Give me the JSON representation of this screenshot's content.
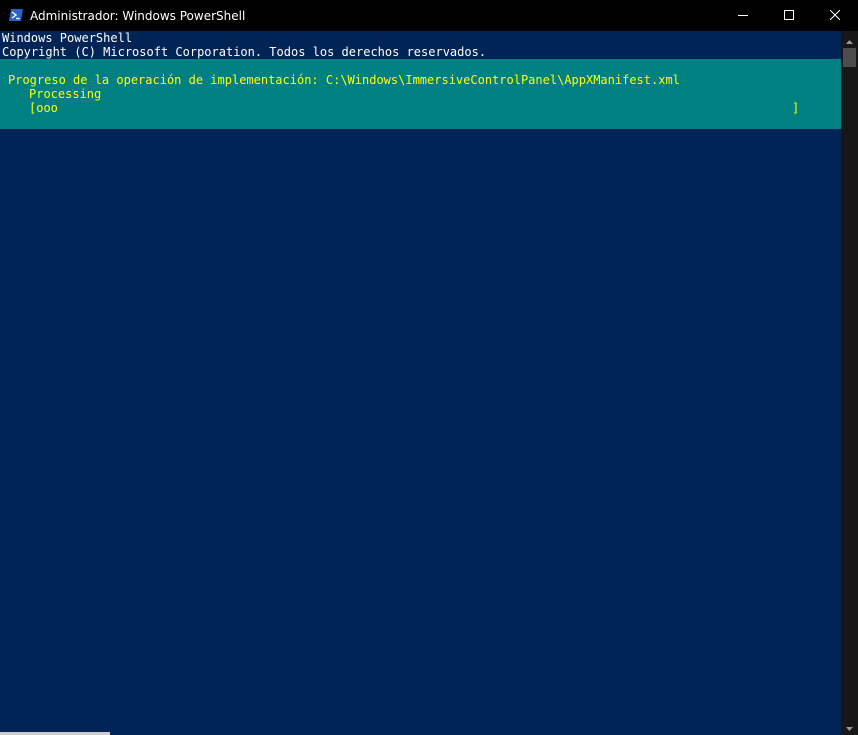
{
  "window": {
    "title": "Administrador: Windows PowerShell",
    "icon": "powershell-icon",
    "controls": {
      "minimize": "minimize-icon",
      "maximize": "maximize-icon",
      "close": "close-icon"
    }
  },
  "console": {
    "lines": [
      "Windows PowerShell",
      "Copyright (C) Microsoft Corporation. Todos los derechos reservados."
    ],
    "progress": {
      "activity": "Progreso de la operación de implementación: C:\\Windows\\ImmersiveControlPanel\\AppXManifest.xml",
      "status": "Processing",
      "bar_start": "[ooo",
      "bar_end": "]",
      "percent_complete": 4
    }
  },
  "colors": {
    "console_background": "#012456",
    "console_text": "#ffffff",
    "progress_background": "#008080",
    "progress_text": "#ffff00",
    "titlebar_background": "#000000"
  }
}
